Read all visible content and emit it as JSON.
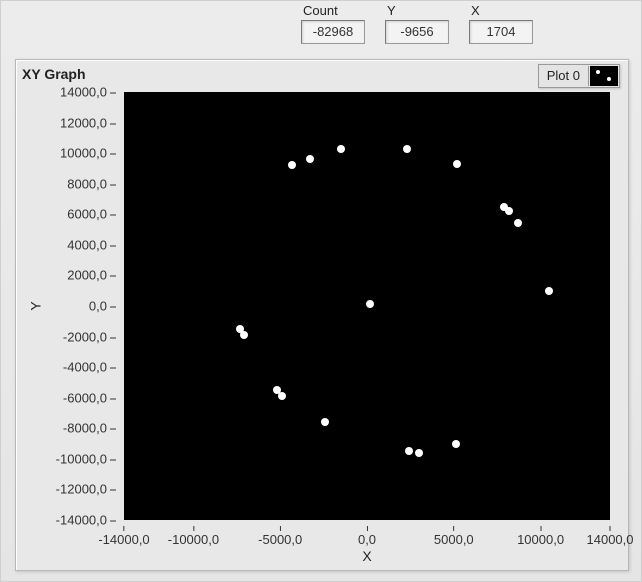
{
  "fields": {
    "count": {
      "label": "Count",
      "value": "-82968"
    },
    "y": {
      "label": "Y",
      "value": "-9656"
    },
    "x": {
      "label": "X",
      "value": "1704"
    }
  },
  "graph": {
    "title": "XY Graph",
    "legend_label": "Plot 0",
    "xlabel": "X",
    "ylabel": "Y"
  },
  "axes": {
    "x": {
      "min": -14000,
      "max": 14000,
      "ticks": [
        -14000,
        -10000,
        -5000,
        0,
        5000,
        10000,
        14000
      ],
      "tick_labels": [
        "-14000,0",
        "-10000,0",
        "-5000,0",
        "0,0",
        "5000,0",
        "10000,0",
        "14000,0"
      ]
    },
    "y": {
      "min": -14000,
      "max": 14000,
      "ticks": [
        14000,
        12000,
        10000,
        8000,
        6000,
        4000,
        2000,
        0,
        -2000,
        -4000,
        -6000,
        -8000,
        -10000,
        -12000,
        -14000
      ],
      "tick_labels": [
        "14000,0",
        "12000,0",
        "10000,0",
        "8000,0",
        "6000,0",
        "4000,0",
        "2000,0",
        "0,0",
        "-2000,0",
        "-4000,0",
        "-6000,0",
        "-8000,0",
        "-10000,0",
        "-12000,0",
        "-14000,0"
      ]
    }
  },
  "chart_data": {
    "type": "scatter",
    "title": "XY Graph",
    "xlabel": "X",
    "ylabel": "Y",
    "xlim": [
      -14000,
      14000
    ],
    "ylim": [
      -14000,
      14000
    ],
    "series": [
      {
        "name": "Plot 0",
        "points": [
          {
            "x": -4300,
            "y": 9200
          },
          {
            "x": -3300,
            "y": 9600
          },
          {
            "x": -1500,
            "y": 10300
          },
          {
            "x": 2300,
            "y": 10300
          },
          {
            "x": 5200,
            "y": 9300
          },
          {
            "x": 7900,
            "y": 6500
          },
          {
            "x": 8200,
            "y": 6200
          },
          {
            "x": 8700,
            "y": 5400
          },
          {
            "x": 10500,
            "y": 1000
          },
          {
            "x": 200,
            "y": 100
          },
          {
            "x": -7300,
            "y": -1500
          },
          {
            "x": -7100,
            "y": -1900
          },
          {
            "x": -5200,
            "y": -5500
          },
          {
            "x": -4900,
            "y": -5900
          },
          {
            "x": -2400,
            "y": -7600
          },
          {
            "x": 2400,
            "y": -9500
          },
          {
            "x": 3000,
            "y": -9600
          },
          {
            "x": 5100,
            "y": -9000
          }
        ]
      }
    ]
  }
}
